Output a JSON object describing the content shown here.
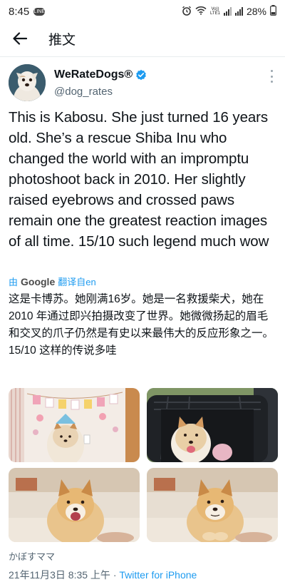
{
  "status_bar": {
    "time": "8:45",
    "line_badge": "LINE",
    "battery": "28%",
    "network_label": "Vo))\nLTE1"
  },
  "header": {
    "title": "推文"
  },
  "author": {
    "name": "WeRateDogs®",
    "handle": "@dog_rates"
  },
  "tweet": {
    "text": "This is Kabosu. She just turned 16 years old. She’s a rescue Shiba Inu who changed the world with an impromptu photoshoot back in 2010. Her slightly raised eyebrows and crossed paws remain one the greatest reaction images of all time. 15/10 such legend much wow",
    "translate_prefix": "由",
    "translate_provider": "Google",
    "translate_suffix": "翻译自en",
    "translated": "这是卡博苏。她刚满16岁。她是一名救援柴犬，她在 2010 年通过即兴拍摄改变了世界。她微微扬起的眉毛和交叉的爪子仍然是有史以来最伟大的反应形象之一。 15/10 这样的传说多哇"
  },
  "media": [
    {
      "name": "photo-birthday-dog"
    },
    {
      "name": "photo-dog-in-stroller"
    },
    {
      "name": "photo-dog-on-couch-mouth-open"
    },
    {
      "name": "photo-dog-on-couch-crossed-paws"
    }
  ],
  "footer": {
    "source": "かぼすママ",
    "date": "21年11月3日",
    "time": "8:35 上午",
    "separator": "·",
    "app": "Twitter for iPhone"
  },
  "colors": {
    "accent": "#1d9bf0",
    "text": "#0f1419",
    "muted": "#536471"
  },
  "icons": {
    "back": "arrow-left-icon",
    "verified": "verified-badge-icon",
    "more": "more-vertical-icon",
    "alarm": "alarm-icon",
    "wifi": "wifi-icon",
    "signal": "signal-icon",
    "battery": "battery-icon"
  }
}
